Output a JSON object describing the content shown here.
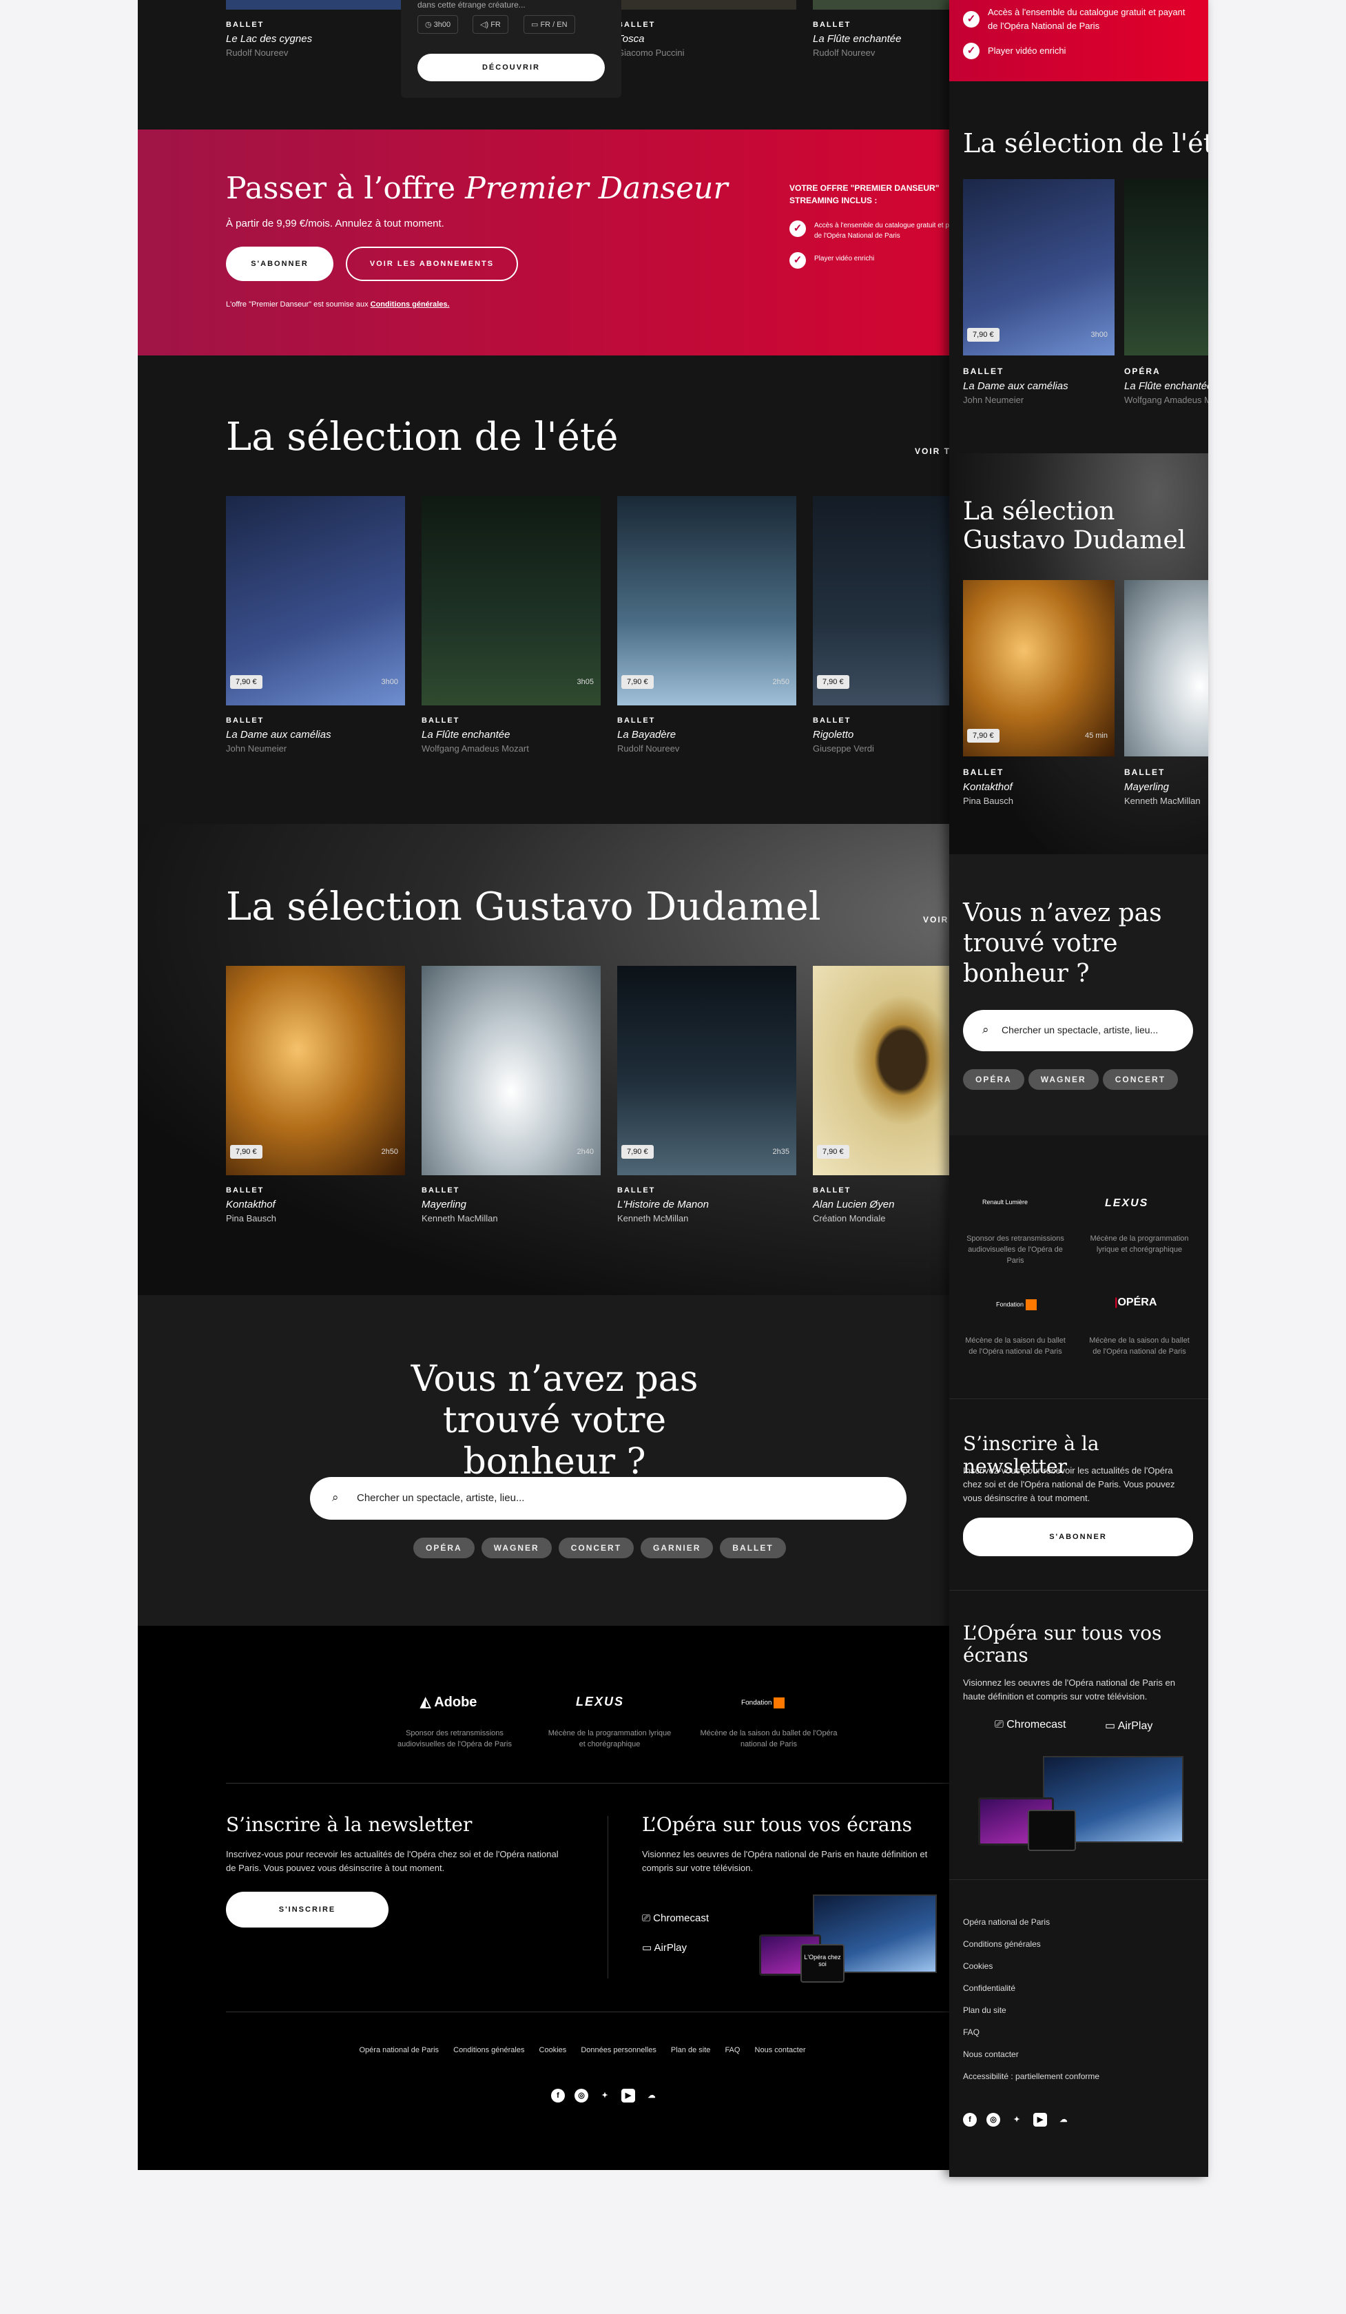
{
  "top": {
    "cards": [
      {
        "category": "BALLET",
        "title": "Le Lac des cygnes",
        "sub": "Rudolf Noureev"
      },
      {
        "category": "BALLET",
        "title": "Tosca",
        "sub": "Giacomo Puccini"
      },
      {
        "category": "BALLET",
        "title": "La Flûte enchantée",
        "sub": "Rudolf Noureev"
      }
    ],
    "overlay": {
      "text": "dans cette étrange créature...",
      "duration": "3h00",
      "audio": "FR",
      "subs": "FR / EN",
      "button": "DÉCOUVRIR"
    }
  },
  "promo": {
    "title_plain": "Passer à l’offre ",
    "title_italic": "Premier Danseur",
    "price": "À partir de 9,99 €/mois. Annulez à tout moment.",
    "subscribe": "S'ABONNER",
    "see_subs": "VOIR LES ABONNEMENTS",
    "notice_plain": "L'offre \"Premier Danseur\" est soumise aux ",
    "notice_link": "Conditions générales.",
    "offer_heading": "VOTRE OFFRE \"PREMIER DANSEUR\" STREAMING INCLUS :",
    "benefits": [
      "Accès à l'ensemble du catalogue gratuit et payant de l'Opéra National de Paris",
      "Player vidéo enrichi"
    ]
  },
  "summer": {
    "title": "La sélection de l'été",
    "see_all": "VOIR TOUT",
    "cards": [
      {
        "price": "7,90 €",
        "duration": "3h00",
        "category": "BALLET",
        "title": "La Dame aux camélias",
        "sub": "John Neumeier",
        "color": "#3a4f8c"
      },
      {
        "price": "",
        "duration": "3h05",
        "category": "BALLET",
        "title": "La Flûte enchantée",
        "sub": "Wolfgang Amadeus Mozart",
        "color": "#1f3326"
      },
      {
        "price": "7,90 €",
        "duration": "2h50",
        "category": "BALLET",
        "title": "La Bayadère",
        "sub": "Rudolf Noureev",
        "color": "#4a6c84"
      },
      {
        "price": "7,90 €",
        "duration": "",
        "category": "BALLET",
        "title": "Rigoletto",
        "sub": "Giuseppe Verdi",
        "color": "#22303e"
      }
    ]
  },
  "dudamel": {
    "title": "La sélection Gustavo Dudamel",
    "see_all": "VOIR TOUT",
    "cards": [
      {
        "price": "7,90 €",
        "duration": "2h50",
        "category": "BALLET",
        "title": "Kontakthof",
        "sub": "Pina Bausch",
        "color": "#b26d19"
      },
      {
        "price": "",
        "duration": "2h40",
        "category": "BALLET",
        "title": "Mayerling",
        "sub": "Kenneth MacMillan",
        "color": "#bfc9cf"
      },
      {
        "price": "7,90 €",
        "duration": "2h35",
        "category": "BALLET",
        "title": "L'Histoire de Manon",
        "sub": "Kenneth McMillan",
        "color": "#1f2e3a"
      },
      {
        "price": "7,90 €",
        "duration": "",
        "category": "BALLET",
        "title": "Alan Lucien Øyen",
        "sub": "Création Mondiale",
        "color": "#d8c68a"
      }
    ]
  },
  "search": {
    "title": "Vous n’avez pas trouvé votre bonheur ?",
    "placeholder": "Chercher un spectacle, artiste, lieu...",
    "chips": [
      "OPÉRA",
      "WAGNER",
      "CONCERT",
      "GARNIER",
      "BALLET"
    ]
  },
  "sponsors": [
    {
      "name": "Adobe",
      "text": "Sponsor des retransmissions audiovisuelles de l'Opéra de Paris"
    },
    {
      "name": "LEXUS",
      "text": "Mécène de la programmation lyrique et chorégraphique"
    },
    {
      "name": "Fondation",
      "text": "Mécène de la saison du ballet de l'Opéra national de Paris"
    }
  ],
  "newsletter": {
    "title": "S’inscrire à la newsletter",
    "text": "Inscrivez-vous pour recevoir les actualités de l'Opéra chez soi et de l'Opéra national de Paris. Vous pouvez vous désinscrire à tout moment.",
    "button": "S'INSCRIRE"
  },
  "screens": {
    "title": "L’Opéra sur tous vos écrans",
    "text": "Visionnez les oeuvres de l'Opéra national de Paris en haute définition et compris sur votre télévision.",
    "chromecast": "Chromecast",
    "airplay": "AirPlay",
    "device_caption": "L'Opéra chez soi"
  },
  "footer": {
    "links": [
      "Opéra national de Paris",
      "Conditions générales",
      "Cookies",
      "Données personnelles",
      "Plan de site",
      "FAQ",
      "Nous contacter"
    ]
  },
  "mobile": {
    "benefits": [
      "Accès à l'ensemble du catalogue gratuit et payant de l'Opéra National de Paris",
      "Player vidéo enrichi"
    ],
    "summer_title": "La sélection de l'été",
    "summer_cards": [
      {
        "price": "7,90 €",
        "duration": "3h00",
        "category": "BALLET",
        "title": "La Dame aux camélias",
        "sub": "John Neumeier",
        "color": "#3a4f8c"
      },
      {
        "category": "OPÉRA",
        "title": "La Flûte enchantée",
        "sub": "Wolfgang Amadeus Mozart",
        "color": "#1f3326"
      }
    ],
    "dudamel_title": "La sélection Gustavo Dudamel",
    "dudamel_cards": [
      {
        "price": "7,90 €",
        "duration": "45 min",
        "category": "BALLET",
        "title": "Kontakthof",
        "sub": "Pina Bausch",
        "color": "#b26d19"
      },
      {
        "category": "BALLET",
        "title": "Mayerling",
        "sub": "Kenneth MacMillan",
        "color": "#bfc9cf"
      }
    ],
    "search_title": "Vous n’avez pas trouvé votre bonheur ?",
    "search_placeholder": "Chercher un spectacle, artiste, lieu...",
    "chips": [
      "OPÉRA",
      "WAGNER",
      "CONCERT"
    ],
    "sponsors": [
      {
        "name": "Renault Lumière",
        "text": "Sponsor des retransmissions audiovisuelles de l'Opéra de Paris"
      },
      {
        "name": "LEXUS",
        "text": "Mécène de la programmation lyrique et chorégraphique"
      },
      {
        "name": "Fondation",
        "text": "Mécène de la saison du ballet de l'Opéra national de Paris"
      },
      {
        "name": "OPÉRA",
        "text": "Mécène de la saison du ballet de l'Opéra national de Paris"
      }
    ],
    "newsletter_title": "S’inscrire à la newsletter",
    "newsletter_text": "Inscrivez-vous pour recevoir les actualités de l'Opéra chez soi et de l'Opéra national de Paris. Vous pouvez vous désinscrire à tout moment.",
    "newsletter_button": "S'ABONNER",
    "screens_title": "L’Opéra sur tous vos écrans",
    "screens_text": "Visionnez les oeuvres de l'Opéra national de Paris en haute définition et compris sur votre télévision.",
    "chromecast": "Chromecast",
    "airplay": "AirPlay",
    "footer_links": [
      "Opéra national de Paris",
      "Conditions générales",
      "Cookies",
      "Confidentialité",
      "Plan du site",
      "FAQ",
      "Nous contacter",
      "Accessibilité : partiellement conforme"
    ]
  },
  "colors": {
    "promo_start": "#a01446",
    "promo_end": "#e2002a",
    "page_bg": "#151515",
    "footer_bg": "#000000"
  }
}
